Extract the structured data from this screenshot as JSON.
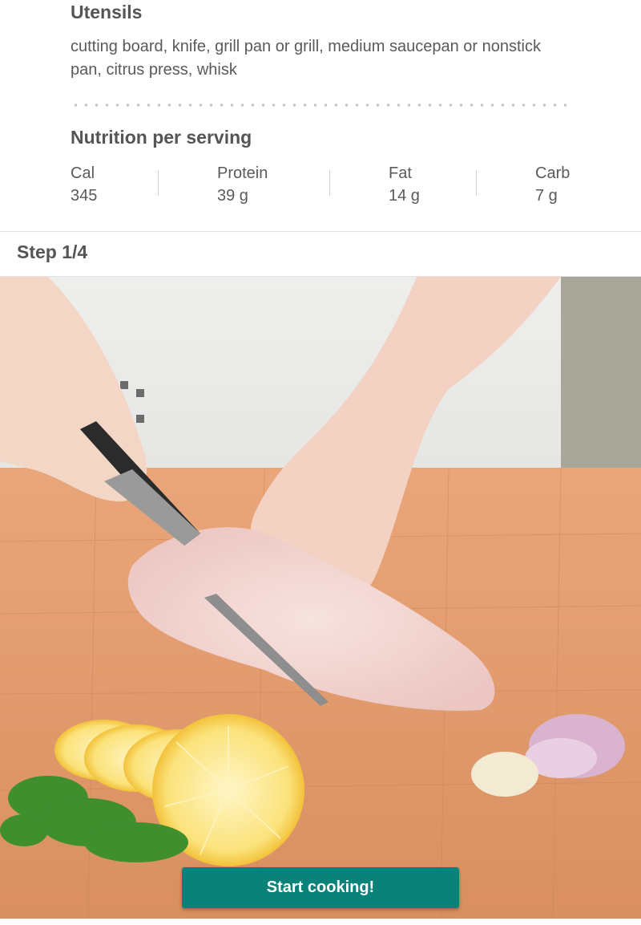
{
  "utensils": {
    "title": "Utensils",
    "text": "cutting board, knife, grill pan or grill, medium saucepan or nonstick pan, citrus press, whisk"
  },
  "nutrition": {
    "title": "Nutrition per serving",
    "items": [
      {
        "label": "Cal",
        "value": "345"
      },
      {
        "label": "Protein",
        "value": "39 g"
      },
      {
        "label": "Fat",
        "value": "14 g"
      },
      {
        "label": "Carb",
        "value": "7 g"
      }
    ]
  },
  "step": {
    "label": "Step 1/4"
  },
  "photo": {
    "icon": "step-photo-chicken-cutting"
  },
  "start_button": {
    "label": "Start cooking!"
  },
  "colors": {
    "accent": "#0b8279",
    "text": "#5a5a5a",
    "divider": "#e3e3e3"
  }
}
